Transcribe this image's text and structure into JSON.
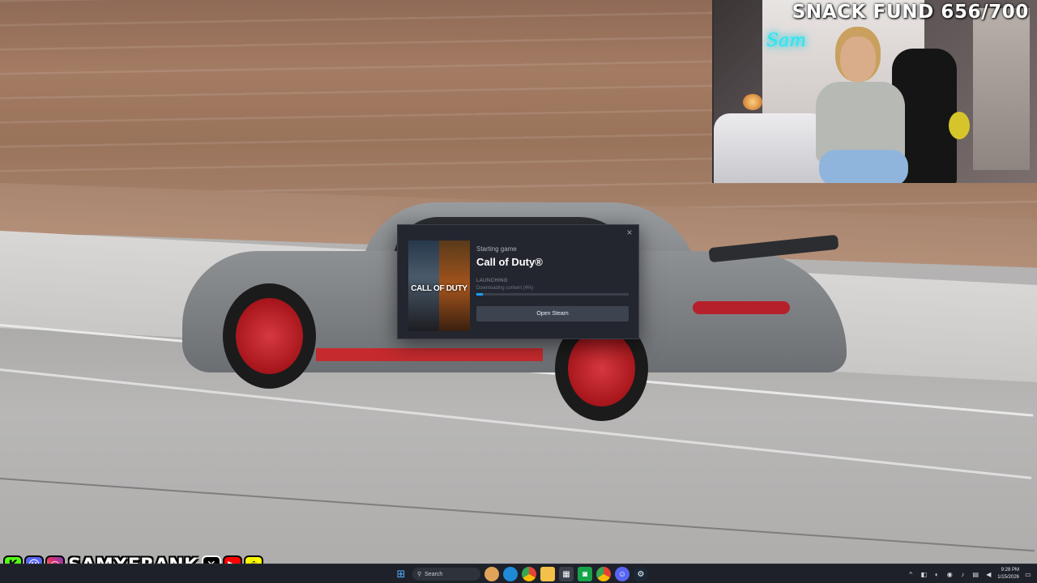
{
  "overlay": {
    "snack_fund": "SNACK FUND 656/700",
    "neon_sign": "Sam"
  },
  "dialog": {
    "starting_label": "Starting game",
    "game_title": "Call of Duty®",
    "cover_title": "CALL OF DUTY",
    "status": "LAUNCHING",
    "sub_status": "Downloading content (4%)",
    "progress": 0.04,
    "button_label": "Open Steam",
    "close_glyph": "×",
    "accent": "#1a9fff"
  },
  "socials": {
    "handle": "SAMXFRANK",
    "icons": [
      "kick-icon",
      "discord-icon",
      "instagram-icon",
      "x-icon",
      "youtube-icon",
      "snapchat-icon"
    ]
  },
  "taskbar": {
    "search_placeholder": "Search",
    "apps": [
      "start-icon",
      "search-icon",
      "widgets-icon",
      "edge-icon",
      "chrome-icon",
      "file-explorer-icon",
      "store-icon",
      "app-icon",
      "chrome-icon",
      "discord-icon",
      "steam-icon"
    ],
    "time": "9:28 PM",
    "date": "1/15/2026"
  }
}
